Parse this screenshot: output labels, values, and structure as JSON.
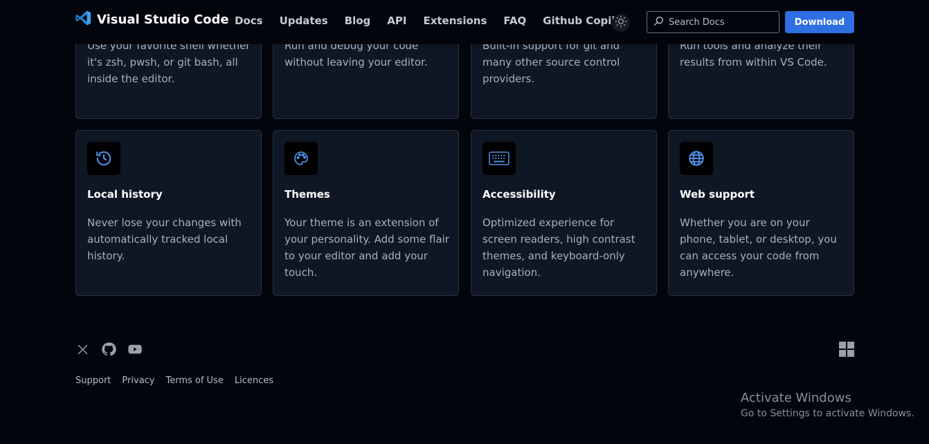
{
  "header": {
    "brand_title": "Visual Studio Code",
    "nav": [
      "Docs",
      "Updates",
      "Blog",
      "API",
      "Extensions",
      "FAQ",
      "Github Copilot"
    ],
    "search_placeholder": "Search Docs",
    "download_label": "Download"
  },
  "top_cards": [
    {
      "desc": "Use your favorite shell whether it's zsh, pwsh, or git bash, all inside the editor."
    },
    {
      "desc": "Run and debug your code without leaving your editor."
    },
    {
      "desc": "Built-in support for git and many other source control providers."
    },
    {
      "desc": "Run tools and analyze their results from within VS Code."
    }
  ],
  "cards": [
    {
      "icon": "history-icon",
      "title": "Local history",
      "desc": "Never lose your changes with automatically tracked local history."
    },
    {
      "icon": "palette-icon",
      "title": "Themes",
      "desc": "Your theme is an extension of your personality. Add some flair to your editor and add your touch."
    },
    {
      "icon": "keyboard-icon",
      "title": "Accessibility",
      "desc": "Optimized experience for screen readers, high contrast themes, and keyboard-only navigation."
    },
    {
      "icon": "globe-icon",
      "title": "Web support",
      "desc": "Whether you are on your phone, tablet, or desktop, you can access your code from anywhere."
    }
  ],
  "footer": {
    "social": [
      "x-icon",
      "github-icon",
      "youtube-icon"
    ],
    "links": [
      "Support",
      "Privacy",
      "Terms of Use",
      "Licences"
    ]
  },
  "activate": {
    "title": "Activate Windows",
    "subtitle": "Go to Settings to activate Windows."
  },
  "colors": {
    "background": "#03050c",
    "card": "#0f1624",
    "accent": "#2f6fe4",
    "icon_blue": "#4d8fe6"
  }
}
